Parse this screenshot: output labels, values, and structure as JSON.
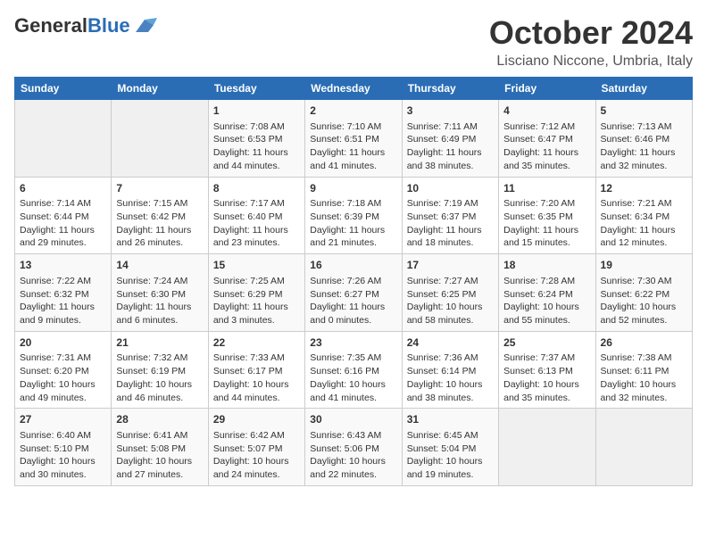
{
  "header": {
    "logo_general": "General",
    "logo_blue": "Blue",
    "month": "October 2024",
    "location": "Lisciano Niccone, Umbria, Italy"
  },
  "days_of_week": [
    "Sunday",
    "Monday",
    "Tuesday",
    "Wednesday",
    "Thursday",
    "Friday",
    "Saturday"
  ],
  "weeks": [
    [
      {
        "day": "",
        "info": ""
      },
      {
        "day": "",
        "info": ""
      },
      {
        "day": "1",
        "info": "Sunrise: 7:08 AM\nSunset: 6:53 PM\nDaylight: 11 hours and 44 minutes."
      },
      {
        "day": "2",
        "info": "Sunrise: 7:10 AM\nSunset: 6:51 PM\nDaylight: 11 hours and 41 minutes."
      },
      {
        "day": "3",
        "info": "Sunrise: 7:11 AM\nSunset: 6:49 PM\nDaylight: 11 hours and 38 minutes."
      },
      {
        "day": "4",
        "info": "Sunrise: 7:12 AM\nSunset: 6:47 PM\nDaylight: 11 hours and 35 minutes."
      },
      {
        "day": "5",
        "info": "Sunrise: 7:13 AM\nSunset: 6:46 PM\nDaylight: 11 hours and 32 minutes."
      }
    ],
    [
      {
        "day": "6",
        "info": "Sunrise: 7:14 AM\nSunset: 6:44 PM\nDaylight: 11 hours and 29 minutes."
      },
      {
        "day": "7",
        "info": "Sunrise: 7:15 AM\nSunset: 6:42 PM\nDaylight: 11 hours and 26 minutes."
      },
      {
        "day": "8",
        "info": "Sunrise: 7:17 AM\nSunset: 6:40 PM\nDaylight: 11 hours and 23 minutes."
      },
      {
        "day": "9",
        "info": "Sunrise: 7:18 AM\nSunset: 6:39 PM\nDaylight: 11 hours and 21 minutes."
      },
      {
        "day": "10",
        "info": "Sunrise: 7:19 AM\nSunset: 6:37 PM\nDaylight: 11 hours and 18 minutes."
      },
      {
        "day": "11",
        "info": "Sunrise: 7:20 AM\nSunset: 6:35 PM\nDaylight: 11 hours and 15 minutes."
      },
      {
        "day": "12",
        "info": "Sunrise: 7:21 AM\nSunset: 6:34 PM\nDaylight: 11 hours and 12 minutes."
      }
    ],
    [
      {
        "day": "13",
        "info": "Sunrise: 7:22 AM\nSunset: 6:32 PM\nDaylight: 11 hours and 9 minutes."
      },
      {
        "day": "14",
        "info": "Sunrise: 7:24 AM\nSunset: 6:30 PM\nDaylight: 11 hours and 6 minutes."
      },
      {
        "day": "15",
        "info": "Sunrise: 7:25 AM\nSunset: 6:29 PM\nDaylight: 11 hours and 3 minutes."
      },
      {
        "day": "16",
        "info": "Sunrise: 7:26 AM\nSunset: 6:27 PM\nDaylight: 11 hours and 0 minutes."
      },
      {
        "day": "17",
        "info": "Sunrise: 7:27 AM\nSunset: 6:25 PM\nDaylight: 10 hours and 58 minutes."
      },
      {
        "day": "18",
        "info": "Sunrise: 7:28 AM\nSunset: 6:24 PM\nDaylight: 10 hours and 55 minutes."
      },
      {
        "day": "19",
        "info": "Sunrise: 7:30 AM\nSunset: 6:22 PM\nDaylight: 10 hours and 52 minutes."
      }
    ],
    [
      {
        "day": "20",
        "info": "Sunrise: 7:31 AM\nSunset: 6:20 PM\nDaylight: 10 hours and 49 minutes."
      },
      {
        "day": "21",
        "info": "Sunrise: 7:32 AM\nSunset: 6:19 PM\nDaylight: 10 hours and 46 minutes."
      },
      {
        "day": "22",
        "info": "Sunrise: 7:33 AM\nSunset: 6:17 PM\nDaylight: 10 hours and 44 minutes."
      },
      {
        "day": "23",
        "info": "Sunrise: 7:35 AM\nSunset: 6:16 PM\nDaylight: 10 hours and 41 minutes."
      },
      {
        "day": "24",
        "info": "Sunrise: 7:36 AM\nSunset: 6:14 PM\nDaylight: 10 hours and 38 minutes."
      },
      {
        "day": "25",
        "info": "Sunrise: 7:37 AM\nSunset: 6:13 PM\nDaylight: 10 hours and 35 minutes."
      },
      {
        "day": "26",
        "info": "Sunrise: 7:38 AM\nSunset: 6:11 PM\nDaylight: 10 hours and 32 minutes."
      }
    ],
    [
      {
        "day": "27",
        "info": "Sunrise: 6:40 AM\nSunset: 5:10 PM\nDaylight: 10 hours and 30 minutes."
      },
      {
        "day": "28",
        "info": "Sunrise: 6:41 AM\nSunset: 5:08 PM\nDaylight: 10 hours and 27 minutes."
      },
      {
        "day": "29",
        "info": "Sunrise: 6:42 AM\nSunset: 5:07 PM\nDaylight: 10 hours and 24 minutes."
      },
      {
        "day": "30",
        "info": "Sunrise: 6:43 AM\nSunset: 5:06 PM\nDaylight: 10 hours and 22 minutes."
      },
      {
        "day": "31",
        "info": "Sunrise: 6:45 AM\nSunset: 5:04 PM\nDaylight: 10 hours and 19 minutes."
      },
      {
        "day": "",
        "info": ""
      },
      {
        "day": "",
        "info": ""
      }
    ]
  ]
}
